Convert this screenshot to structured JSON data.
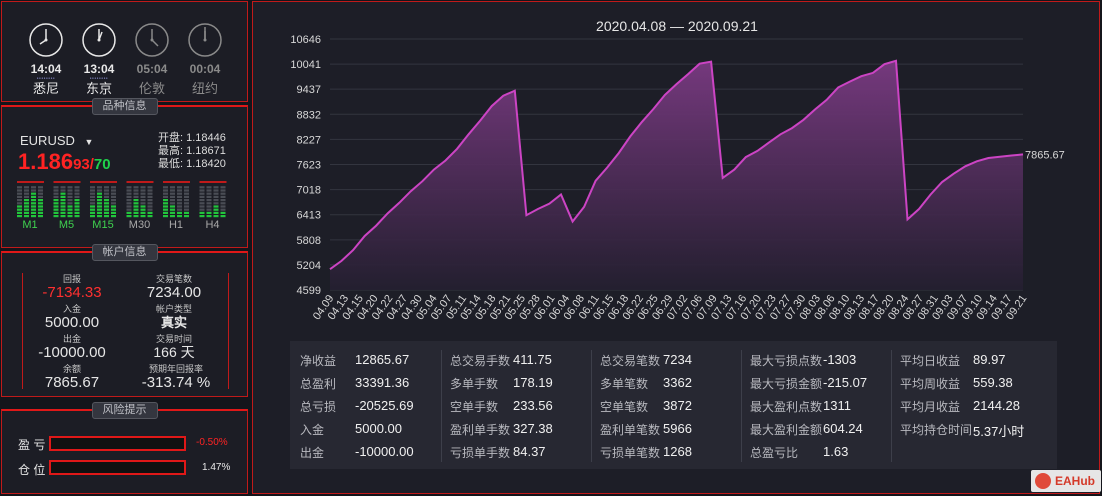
{
  "clocks": [
    {
      "time": "14:04",
      "city": "悉尼",
      "active": true
    },
    {
      "time": "13:04",
      "city": "东京",
      "active": true
    },
    {
      "time": "05:04",
      "city": "伦敦",
      "active": false
    },
    {
      "time": "00:04",
      "city": "纽约",
      "active": false
    }
  ],
  "symbol_panel": {
    "title": "品种信息",
    "symbol": "EURUSD",
    "price_main": "1.186",
    "price_fraction": "93",
    "price_sep": "/",
    "price_spread": "70",
    "open_label": "开盘:",
    "open": "1.18446",
    "high_label": "最高:",
    "high": "1.18671",
    "low_label": "最低:",
    "low": "1.18420",
    "timeframes": [
      "M1",
      "M5",
      "M15",
      "M30",
      "H1",
      "H4"
    ]
  },
  "account": {
    "title": "帐户信息",
    "return_label": "回报",
    "return": "-7134.33",
    "trades_label": "交易笔数",
    "trades": "7234.00",
    "deposit_label": "入金",
    "deposit": "5000.00",
    "type_label": "帐户类型",
    "type": "真实",
    "withdraw_label": "出金",
    "withdraw": "-10000.00",
    "time_label": "交易时间",
    "time": "166 天",
    "balance_label": "余额",
    "balance": "7865.67",
    "annual_label": "预期年回报率",
    "annual": "-313.74 %"
  },
  "risk": {
    "title": "风险提示",
    "pnl_label": "盈 亏",
    "pnl": "-0.50%",
    "pos_label": "仓 位",
    "pos": "1.47%"
  },
  "chart_data": {
    "type": "area",
    "title": "2020.04.08 — 2020.09.21",
    "yticks": [
      10646,
      10041,
      9437,
      8832,
      8227,
      7623,
      7018,
      6413,
      5808,
      5204,
      4599
    ],
    "ylim": [
      4599,
      10646
    ],
    "end_label": "7865.67",
    "x": [
      "04.09",
      "04.13",
      "04.15",
      "04.20",
      "04.22",
      "04.27",
      "04.30",
      "05.04",
      "05.07",
      "05.11",
      "05.14",
      "05.18",
      "05.21",
      "05.25",
      "05.28",
      "06.01",
      "06.04",
      "06.08",
      "06.11",
      "06.15",
      "06.18",
      "06.22",
      "06.25",
      "06.29",
      "07.02",
      "07.06",
      "07.09",
      "07.13",
      "07.16",
      "07.20",
      "07.23",
      "07.27",
      "07.30",
      "08.03",
      "08.06",
      "08.10",
      "08.13",
      "08.17",
      "08.20",
      "08.24",
      "08.27",
      "08.31",
      "09.03",
      "09.07",
      "09.10",
      "09.14",
      "09.17",
      "09.21"
    ],
    "series": [
      {
        "values": [
          5100,
          5300,
          5560,
          5900,
          6150,
          6450,
          6700,
          6980,
          7220,
          7500,
          7720,
          8000,
          8350,
          8680,
          9030,
          9280,
          9400,
          6400,
          6550,
          6680,
          6900,
          6250,
          6600,
          7230,
          7550,
          7900,
          8300,
          8650,
          8960,
          9300,
          9560,
          9800,
          10050,
          10100,
          7300,
          7500,
          7800,
          7950,
          8150,
          8350,
          8500,
          8700,
          8950,
          9180,
          9480,
          9620,
          9750,
          9830,
          10040,
          10120,
          6300,
          6550,
          6900,
          7200,
          7400,
          7580,
          7700,
          7780,
          7810,
          7840,
          7866
        ]
      }
    ]
  },
  "stats": {
    "col1": [
      {
        "label": "净收益",
        "value": "12865.67"
      },
      {
        "label": "总盈利",
        "value": "33391.36"
      },
      {
        "label": "总亏损",
        "value": "-20525.69"
      },
      {
        "label": "入金",
        "value": "5000.00"
      },
      {
        "label": "出金",
        "value": "-10000.00"
      }
    ],
    "col2": [
      {
        "label": "总交易手数",
        "value": "411.75"
      },
      {
        "label": "多单手数",
        "value": "178.19"
      },
      {
        "label": "空单手数",
        "value": "233.56"
      },
      {
        "label": "盈利单手数",
        "value": "327.38"
      },
      {
        "label": "亏损单手数",
        "value": "84.37"
      }
    ],
    "col3": [
      {
        "label": "总交易笔数",
        "value": "7234"
      },
      {
        "label": "多单笔数",
        "value": "3362"
      },
      {
        "label": "空单笔数",
        "value": "3872"
      },
      {
        "label": "盈利单笔数",
        "value": "5966"
      },
      {
        "label": "亏损单笔数",
        "value": "1268"
      }
    ],
    "col4": [
      {
        "label": "最大亏损点数",
        "value": "-1303"
      },
      {
        "label": "最大亏损金额",
        "value": "-215.07"
      },
      {
        "label": "最大盈利点数",
        "value": "1311"
      },
      {
        "label": "最大盈利金额",
        "value": "604.24"
      },
      {
        "label": "总盈亏比",
        "value": "1.63"
      }
    ],
    "col5": [
      {
        "label": "平均日收益",
        "value": "89.97"
      },
      {
        "label": "平均周收益",
        "value": "559.38"
      },
      {
        "label": "平均月收益",
        "value": "2144.28"
      },
      {
        "label": "平均持仓时间",
        "value": "5.37小时"
      }
    ]
  },
  "watermark": "EAHub",
  "colors": {
    "border": "#c01a1a",
    "price_red": "#ff2323",
    "spread_green": "#1fd14b",
    "line": "#cc44c4",
    "fill_top": "#7a3a82",
    "bar_green": "#22c53c"
  }
}
